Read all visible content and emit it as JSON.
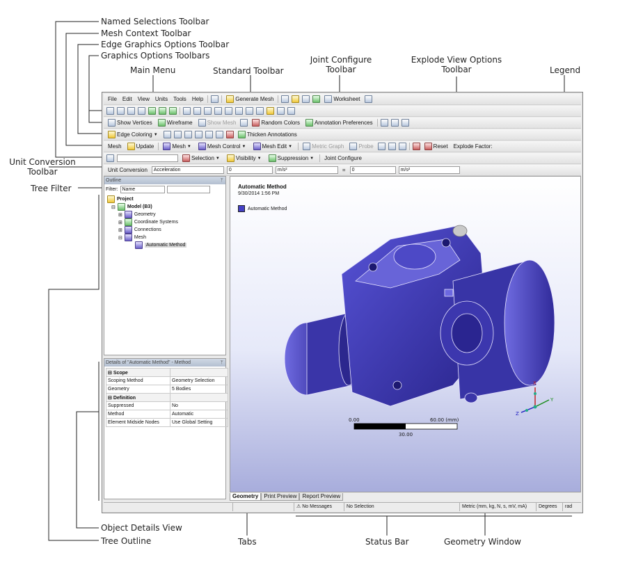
{
  "callouts": {
    "named_selections": "Named Selections Toolbar",
    "mesh_context": "Mesh Context Toolbar",
    "edge_graphics": "Edge Graphics Options Toolbar",
    "graphics_options": "Graphics Options Toolbars",
    "main_menu": "Main Menu",
    "standard_toolbar": "Standard Toolbar",
    "joint_configure_1": "Joint Configure",
    "joint_configure_2": "Toolbar",
    "explode_1": "Explode View Options",
    "explode_2": "Toolbar",
    "legend": "Legend",
    "unit_conversion_1": "Unit Conversion",
    "unit_conversion_2": "Toolbar",
    "tree_filter": "Tree Filter",
    "object_details": "Object Details View",
    "tree_outline": "Tree Outline",
    "tabs": "Tabs",
    "status_bar": "Status Bar",
    "geometry_window": "Geometry Window"
  },
  "menu": [
    "File",
    "Edit",
    "View",
    "Units",
    "Tools",
    "Help"
  ],
  "standard_toolbar": {
    "generate_mesh": "Generate Mesh",
    "worksheet": "Worksheet"
  },
  "graphics_bar": {
    "show_vertices": "Show Vertices",
    "wireframe": "Wireframe",
    "show_mesh": "Show Mesh",
    "random_colors": "Random Colors",
    "annotation_prefs": "Annotation Preferences"
  },
  "edge_bar": {
    "edge_coloring": "Edge Coloring",
    "thicken": "Thicken Annotations"
  },
  "mesh_bar": {
    "mesh": "Mesh",
    "update": "Update",
    "mesh_dd": "Mesh",
    "mesh_control": "Mesh Control",
    "mesh_edit": "Mesh Edit",
    "metric_graph": "Metric Graph",
    "probe": "Probe",
    "reset": "Reset",
    "explode_factor": "Explode Factor:"
  },
  "named_bar": {
    "selection": "Selection",
    "visibility": "Visibility",
    "suppression": "Suppression",
    "joint_configure": "Joint Configure"
  },
  "unit_bar": {
    "label": "Unit Conversion",
    "quantity": "Acceleration",
    "value1": "0",
    "unit1": "m/s²",
    "equals": "=",
    "value2": "0",
    "unit2": "m/s²"
  },
  "outline": {
    "title": "Outline",
    "filter_label": "Filter:",
    "filter_value": "Name",
    "nodes": [
      "Project",
      "Model (B3)",
      "Geometry",
      "Coordinate Systems",
      "Connections",
      "Mesh",
      "Automatic Method"
    ]
  },
  "details": {
    "title": "Details of \"Automatic Method\" - Method",
    "scope_header": "Scope",
    "definition_header": "Definition",
    "scope_rows": [
      [
        "Scoping Method",
        "Geometry Selection"
      ],
      [
        "Geometry",
        "5 Bodies"
      ]
    ],
    "definition_rows": [
      [
        "Suppressed",
        "No"
      ],
      [
        "Method",
        "Automatic"
      ],
      [
        "Element Midside Nodes",
        "Use Global Setting"
      ]
    ]
  },
  "geometry": {
    "title": "Automatic Method",
    "date": "9/30/2014 1:56 PM",
    "legend_item": "Automatic Method",
    "scale_start": "0.00",
    "scale_end": "60.00 (mm)",
    "scale_mid": "30.00",
    "axis_x": "X",
    "axis_y": "Y",
    "axis_z": "Z"
  },
  "tabs": [
    "Geometry",
    "Print Preview",
    "Report Preview"
  ],
  "status": {
    "messages": "No Messages",
    "selection": "No Selection",
    "units": "Metric (mm, kg, N, s, mV, mA)",
    "angle": "Degrees",
    "rad": "rad"
  },
  "colors": {
    "model": "#3f3bb5",
    "model_dark": "#221d7a",
    "accent": "#2d2a9c"
  }
}
